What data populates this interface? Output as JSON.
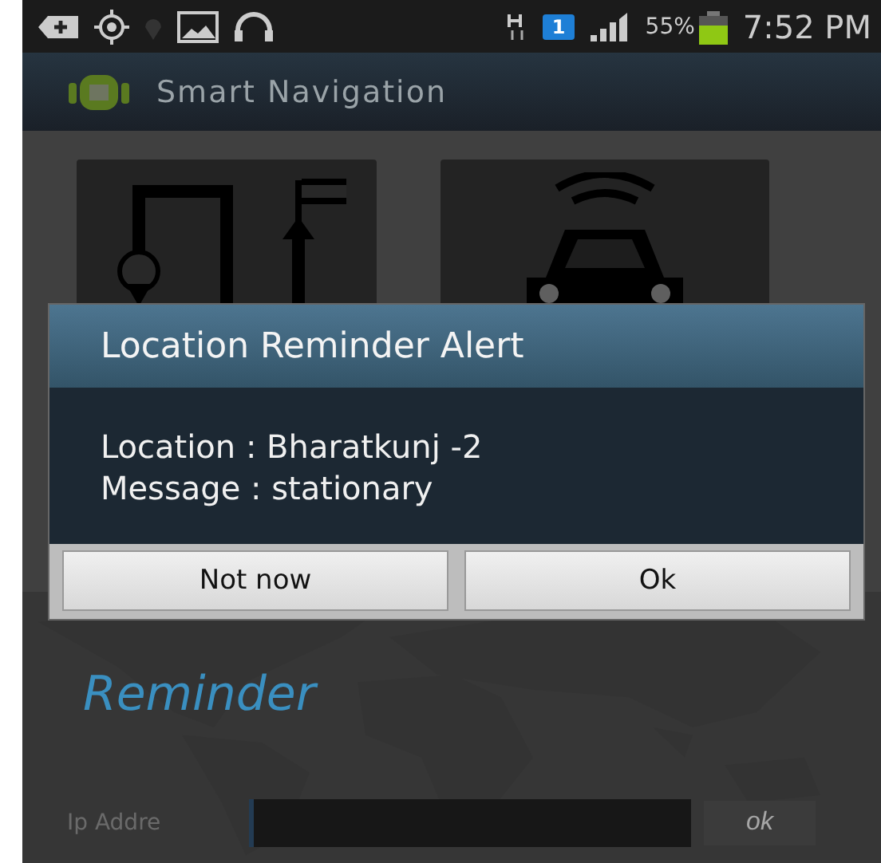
{
  "status_bar": {
    "network_badge": "1",
    "battery_percent": "55%",
    "time": "7:52 PM"
  },
  "action_bar": {
    "title": "Smart Navigation"
  },
  "tiles": [
    {
      "kind": "route"
    },
    {
      "kind": "car"
    }
  ],
  "background_label": "Reminder",
  "ip_row": {
    "label": "Ip Addre",
    "button": "ok"
  },
  "dialog": {
    "title": "Location Reminder Alert",
    "lines": [
      "Location : Bharatkunj -2",
      "Message : stationary"
    ],
    "buttons": [
      "Not now",
      "Ok"
    ]
  }
}
